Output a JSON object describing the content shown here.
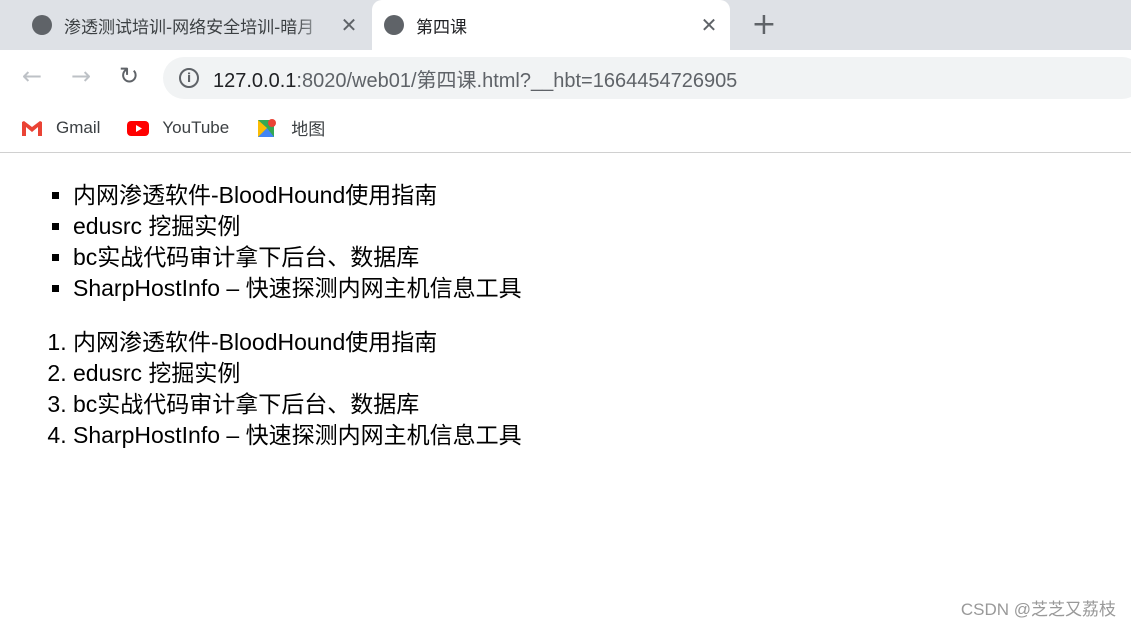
{
  "tabs": [
    {
      "title": "渗透测试培训-网络安全培训-暗月",
      "active": false
    },
    {
      "title": "第四课",
      "active": true
    }
  ],
  "toolbar": {
    "url_host": "127.0.0.1",
    "url_rest": ":8020/web01/第四课.html?__hbt=1664454726905"
  },
  "bookmarks": [
    {
      "label": "Gmail",
      "icon": "gmail-icon"
    },
    {
      "label": "YouTube",
      "icon": "youtube-icon"
    },
    {
      "label": "地图",
      "icon": "maps-icon"
    }
  ],
  "content": {
    "unordered": [
      "内网渗透软件-BloodHound使用指南",
      "edusrc 挖掘实例",
      "bc实战代码审计拿下后台、数据库",
      "SharpHostInfo – 快速探测内网主机信息工具"
    ],
    "ordered": [
      "内网渗透软件-BloodHound使用指南",
      "edusrc 挖掘实例",
      "bc实战代码审计拿下后台、数据库",
      "SharpHostInfo – 快速探测内网主机信息工具"
    ]
  },
  "watermark": "CSDN @芝芝又荔枝"
}
